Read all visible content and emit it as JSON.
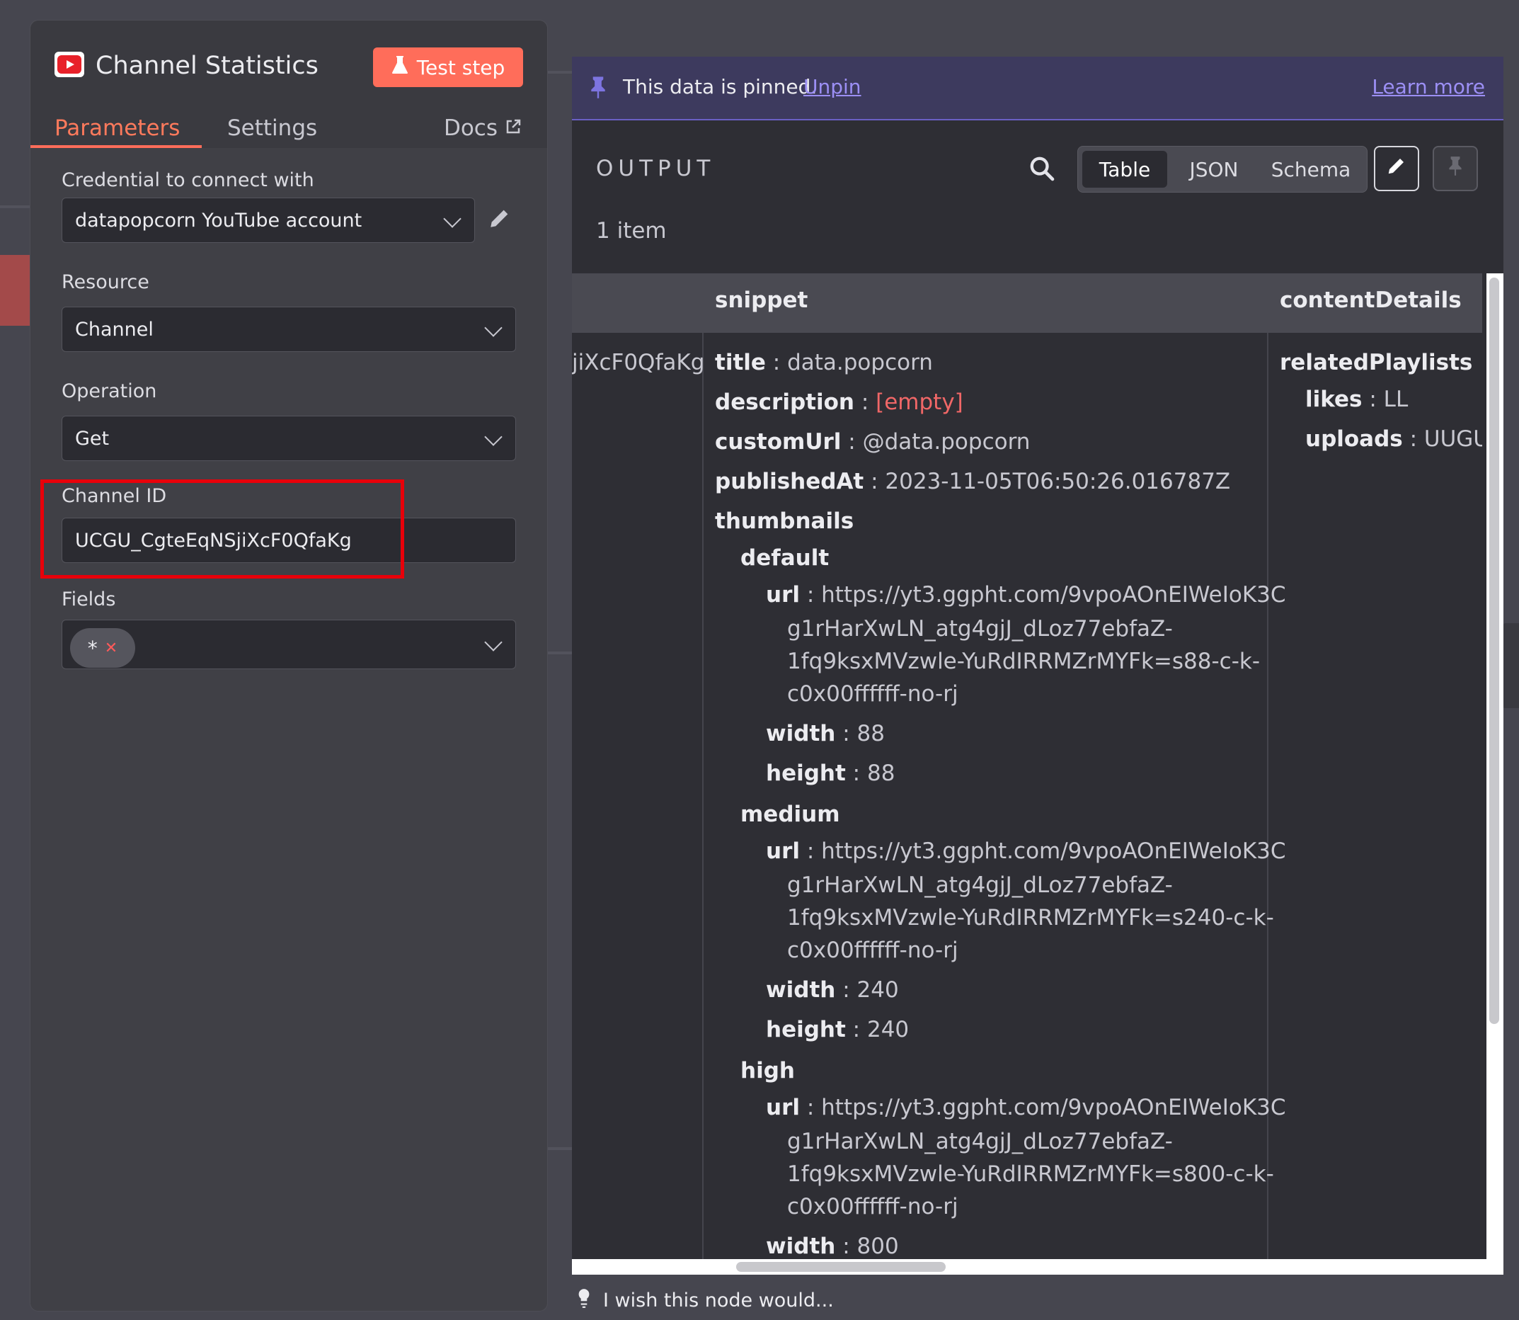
{
  "node": {
    "title": "Channel Statistics",
    "test_button": "Test step",
    "tabs": [
      {
        "label": "Parameters",
        "active": true
      },
      {
        "label": "Settings",
        "active": false
      }
    ],
    "docs_label": "Docs"
  },
  "params": {
    "credential": {
      "label": "Credential to connect with",
      "value": "datapopcorn YouTube account"
    },
    "resource": {
      "label": "Resource",
      "value": "Channel"
    },
    "operation": {
      "label": "Operation",
      "value": "Get"
    },
    "channel_id": {
      "label": "Channel ID",
      "value": "UCGU_CgteEqNSjiXcF0QfaKg"
    },
    "fields": {
      "label": "Fields",
      "chip": "*"
    }
  },
  "output": {
    "pinned_text": "This data is pinned.",
    "unpin_label": "Unpin",
    "learn_more_label": "Learn more",
    "title": "OUTPUT",
    "views": [
      "Table",
      "JSON",
      "Schema"
    ],
    "active_view": "Table",
    "item_count": "1 item",
    "columns": [
      "snippet",
      "contentDetails"
    ],
    "row_id_fragment": "jiXcF0QfaKg",
    "snippet": {
      "title": {
        "key": "title",
        "value": "data.popcorn"
      },
      "description": {
        "key": "description",
        "value": "[empty]"
      },
      "customUrl": {
        "key": "customUrl",
        "value": "@data.popcorn"
      },
      "publishedAt": {
        "key": "publishedAt",
        "value": "2023-11-05T06:50:26.016787Z"
      },
      "thumbnails_key": "thumbnails",
      "default": {
        "key": "default",
        "url_key": "url",
        "url_lines": [
          "https://yt3.ggpht.com/9vpoAOnEIWeIoK3C",
          "g1rHarXwLN_atg4gjJ_dLoz77ebfaZ-",
          "1fq9ksxMVzwle-YuRdIRRMZrMYFk=s88-c-k-",
          "c0x00ffffff-no-rj"
        ],
        "width_key": "width",
        "width": "88",
        "height_key": "height",
        "height": "88"
      },
      "medium": {
        "key": "medium",
        "url_key": "url",
        "url_lines": [
          "https://yt3.ggpht.com/9vpoAOnEIWeIoK3C",
          "g1rHarXwLN_atg4gjJ_dLoz77ebfaZ-",
          "1fq9ksxMVzwle-YuRdIRRMZrMYFk=s240-c-k-",
          "c0x00ffffff-no-rj"
        ],
        "width_key": "width",
        "width": "240",
        "height_key": "height",
        "height": "240"
      },
      "high": {
        "key": "high",
        "url_key": "url",
        "url_lines": [
          "https://yt3.ggpht.com/9vpoAOnEIWeIoK3C",
          "g1rHarXwLN_atg4gjJ_dLoz77ebfaZ-",
          "1fq9ksxMVzwle-YuRdIRRMZrMYFk=s800-c-k-",
          "c0x00ffffff-no-rj"
        ],
        "width_key": "width",
        "width": "800"
      }
    },
    "contentDetails": {
      "relatedPlaylists_key": "relatedPlaylists",
      "likes": {
        "key": "likes",
        "value": "LL"
      },
      "uploads": {
        "key": "uploads",
        "value": "UUGU_"
      }
    }
  },
  "footer": {
    "wish_text": "I wish this node would..."
  },
  "colors": {
    "accent": "#ff6d5a",
    "pinned_bg": "#3d3a5e",
    "link": "#9c8ff5",
    "highlight_box": "#e8000a",
    "empty": "#f06767"
  }
}
